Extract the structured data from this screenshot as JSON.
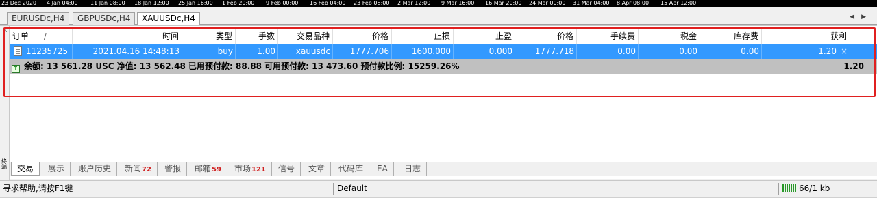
{
  "time_axis": [
    "23 Dec 2020",
    "4 Jan 04:00",
    "11 Jan 08:00",
    "18 Jan 12:00",
    "25 Jan 16:00",
    "1 Feb 20:00",
    "9 Feb 00:00",
    "16 Feb 04:00",
    "23 Feb 08:00",
    "2 Mar 12:00",
    "9 Mar 16:00",
    "16 Mar 20:00",
    "24 Mar 00:00",
    "31 Mar 04:00",
    "8 Apr 08:00",
    "15 Apr 12:00"
  ],
  "chart_tabs": [
    "EURUSDc,H4",
    "GBPUSDc,H4",
    "XAUUSDc,H4"
  ],
  "tab_arrows": "◀▶",
  "terminal": {
    "close_glyph": "×",
    "side_label": "终端",
    "columns": [
      "订单",
      "/",
      "时间",
      "类型",
      "手数",
      "交易品种",
      "价格",
      "止损",
      "止盈",
      "价格",
      "手续费",
      "税金",
      "库存费",
      "获利"
    ],
    "order": {
      "ticket": "11235725",
      "time": "2021.04.16 14:48:13",
      "type": "buy",
      "lots": "1.00",
      "symbol": "xauusdc",
      "open_price": "1777.706",
      "sl": "1600.000",
      "tp": "0.000",
      "price": "1777.718",
      "commission": "0.00",
      "taxes": "0.00",
      "swap": "0.00",
      "profit": "1.20",
      "close_glyph": "×"
    },
    "balance_line": "余额: 13 561.28 USC  净值: 13 562.48  已用预付款: 88.88  可用预付款: 13 473.60  预付款比例: 15259.26%",
    "balance_profit": "1.20"
  },
  "bottom_tabs": [
    {
      "label": "交易",
      "badge": ""
    },
    {
      "label": "展示",
      "badge": ""
    },
    {
      "label": "账户历史",
      "badge": ""
    },
    {
      "label": "新闻",
      "badge": "72"
    },
    {
      "label": "警报",
      "badge": ""
    },
    {
      "label": "邮箱",
      "badge": "59"
    },
    {
      "label": "市场",
      "badge": "121"
    },
    {
      "label": "信号",
      "badge": ""
    },
    {
      "label": "文章",
      "badge": ""
    },
    {
      "label": "代码库",
      "badge": ""
    },
    {
      "label": "EA",
      "badge": ""
    },
    {
      "label": "日志",
      "badge": ""
    }
  ],
  "status": {
    "help": "寻求帮助,请按F1键",
    "profile": "Default",
    "traffic": "66/1 kb"
  },
  "colors": {
    "selection": "#3399ff",
    "highlight_border": "#e02020",
    "badge": "#d02020"
  }
}
